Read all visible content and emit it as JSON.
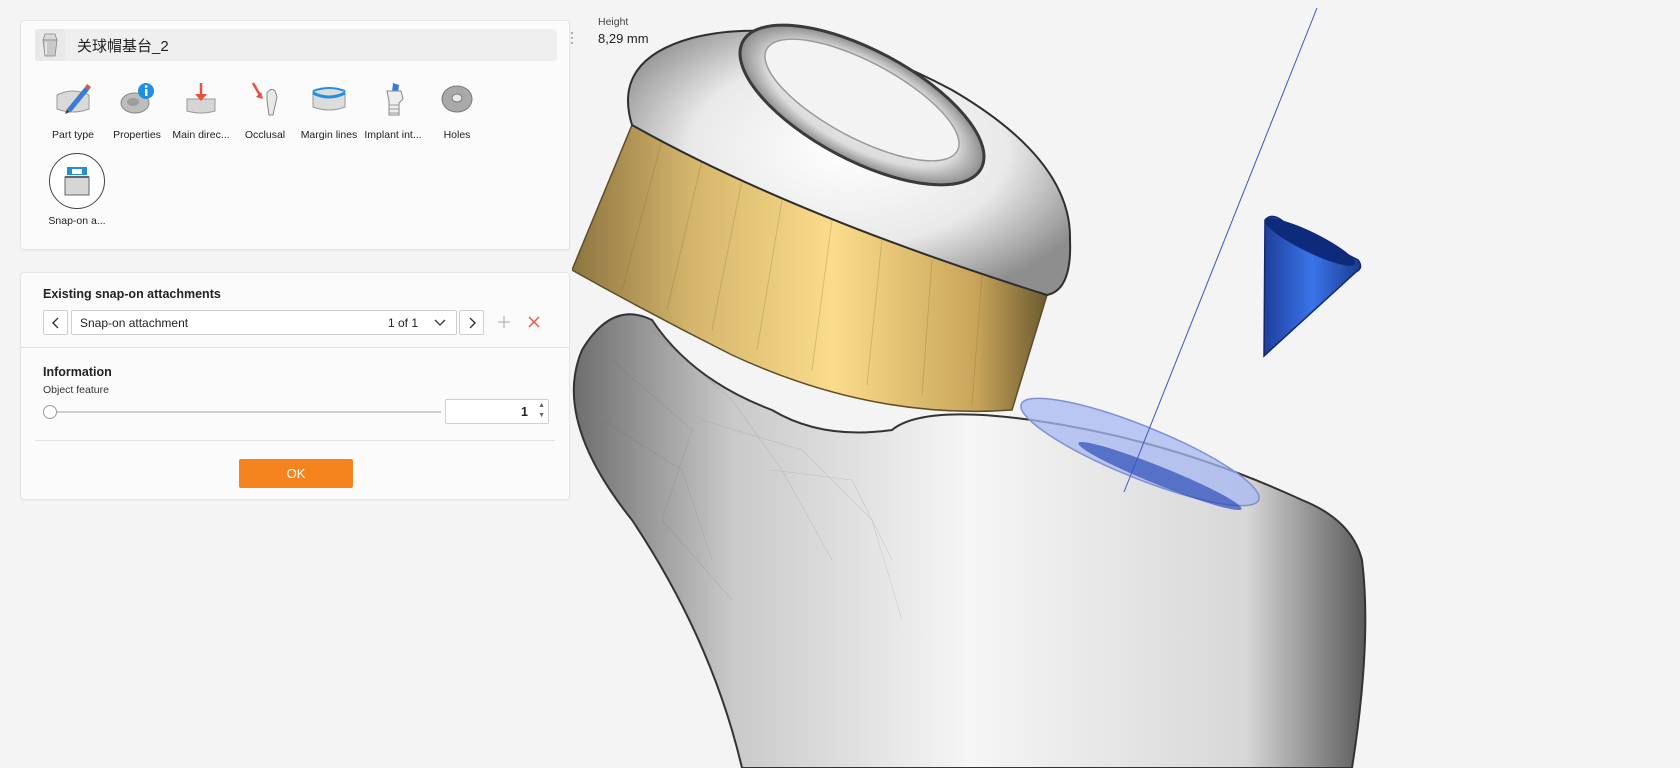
{
  "part": {
    "title": "关球帽基台_2"
  },
  "tools": [
    {
      "label": "Part type",
      "icon": "part-type-icon"
    },
    {
      "label": "Properties",
      "icon": "properties-icon"
    },
    {
      "label": "Main direc...",
      "icon": "main-direction-icon"
    },
    {
      "label": "Occlusal",
      "icon": "occlusal-icon"
    },
    {
      "label": "Margin lines",
      "icon": "margin-lines-icon"
    },
    {
      "label": "Implant int...",
      "icon": "implant-interface-icon"
    },
    {
      "label": "Holes",
      "icon": "holes-icon"
    }
  ],
  "active_tool": {
    "label": "Snap-on a...",
    "icon": "snap-on-attachment-icon"
  },
  "attachments": {
    "heading": "Existing snap-on attachments",
    "selected": "Snap-on attachment",
    "count": "1 of 1"
  },
  "information": {
    "heading": "Information",
    "feature_label": "Object feature",
    "feature_value": "1",
    "slider_fraction": 0
  },
  "ok_label": "OK",
  "hud": {
    "label": "Height",
    "value": "8,29 mm"
  },
  "colors": {
    "accent": "#f5841f",
    "gold_ring": "#f1cf7b",
    "cone_blue": "#2d5fd6",
    "disc_blue": "#a7b8f2",
    "delete_red": "#e5533d"
  }
}
